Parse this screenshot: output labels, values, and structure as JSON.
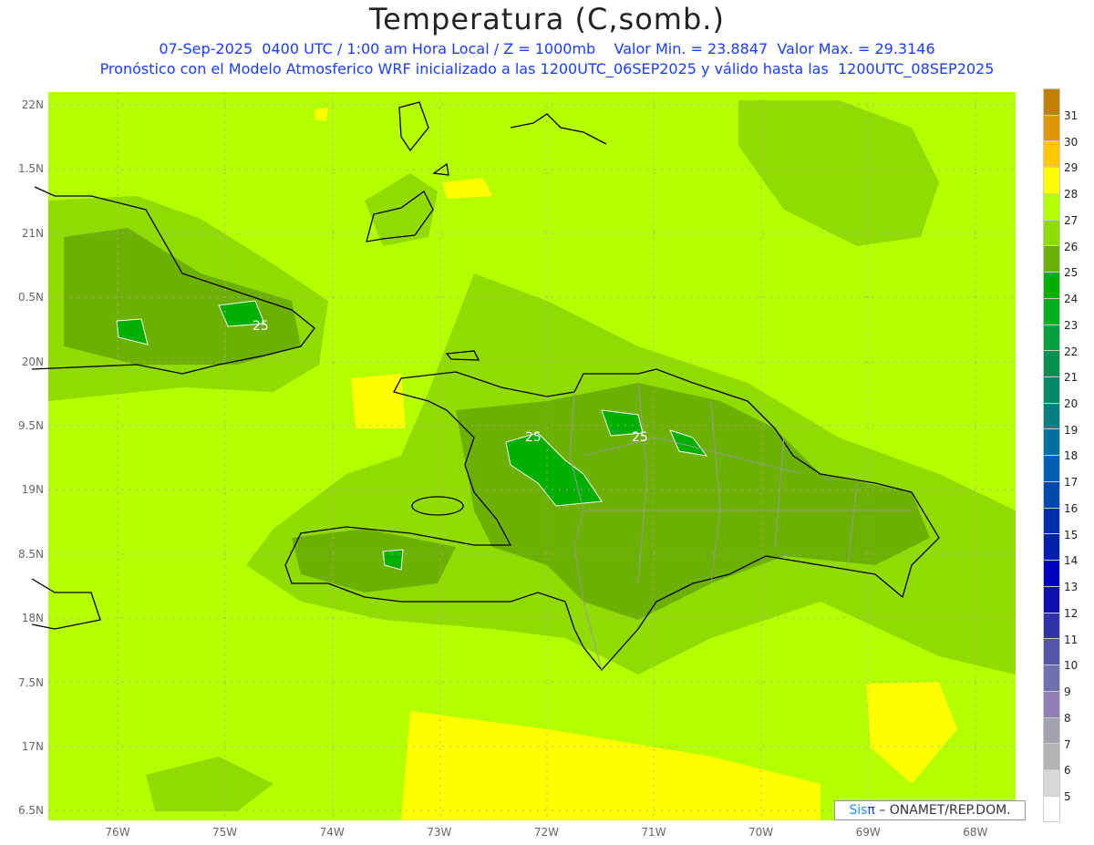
{
  "header": {
    "title": "Temperatura (C,somb.)",
    "line1": "07-Sep-2025  0400 UTC / 1:00 am Hora Local / Z = 1000mb    Valor Min. = 23.8847  Valor Max. = 29.3146",
    "line2": "Pronóstico con el Modelo Atmosferico WRF inicializado a las 1200UTC_06SEP2025 y válido hasta las  1200UTC_08SEP2025"
  },
  "axes": {
    "lat_labels": [
      "22N",
      "1.5N",
      "21N",
      "0.5N",
      "20N",
      "9.5N",
      "19N",
      "8.5N",
      "18N",
      "7.5N",
      "17N",
      "6.5N"
    ],
    "lon_labels": [
      "76W",
      "75W",
      "74W",
      "73W",
      "72W",
      "71W",
      "70W",
      "69W",
      "68W"
    ]
  },
  "contour_labels": [
    "25",
    "25",
    "25"
  ],
  "colorbar": {
    "labels": [
      "31",
      "30",
      "29",
      "28",
      "27",
      "26",
      "25",
      "24",
      "23",
      "22",
      "21",
      "20",
      "19",
      "18",
      "17",
      "16",
      "15",
      "14",
      "13",
      "12",
      "11",
      "10",
      "9",
      "8",
      "7",
      "6",
      "5"
    ],
    "colors_top_to_bottom": [
      "#c08000",
      "#e09600",
      "#ffc800",
      "#ffff00",
      "#b4ff00",
      "#90dc00",
      "#6cb000",
      "#00b000",
      "#00b020",
      "#00a040",
      "#009050",
      "#008868",
      "#008080",
      "#0070a0",
      "#0060b0",
      "#0048b0",
      "#0030b0",
      "#0020b0",
      "#0000c0",
      "#1010b0",
      "#3232aa",
      "#5555aa",
      "#7070b0",
      "#8f7fb5",
      "#a3a3ad",
      "#b3b3b3",
      "#d7d7d7",
      "#ffffff"
    ]
  },
  "credit": {
    "sis": "Sis",
    "pi": "π",
    "rest": " – ONAMET/REP.DOM."
  }
}
